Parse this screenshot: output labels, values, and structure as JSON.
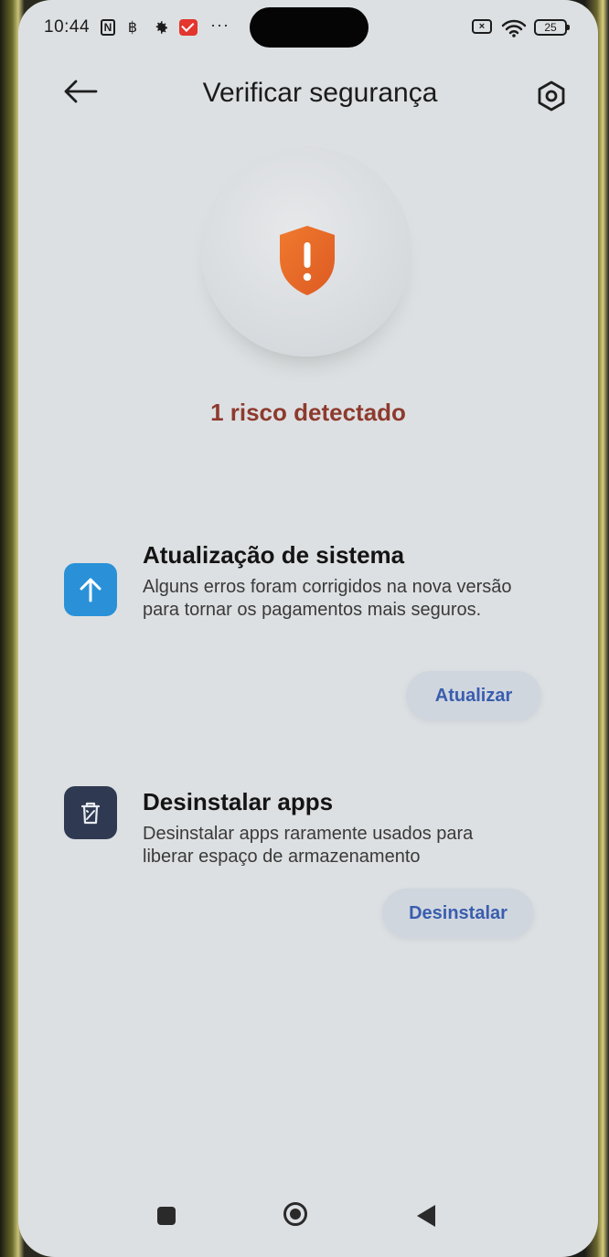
{
  "status_bar": {
    "time": "10:44",
    "nfc_glyph": "N",
    "sim_glyph": "฿",
    "more_glyph": "···",
    "battery_x_glyph": "×",
    "battery_level": "25",
    "icons": [
      "nfc-icon",
      "sim-icon",
      "gear-icon",
      "mail-icon",
      "more-icon",
      "battery-saver-icon",
      "wifi-icon",
      "battery-icon"
    ]
  },
  "header": {
    "title": "Verificar segurança",
    "back_icon": "arrow-left-icon",
    "settings_icon": "hexagon-settings-icon"
  },
  "summary": {
    "status_icon": "shield-warning-icon",
    "status_text": "1 risco detectado",
    "status_color": "#8e3a2e",
    "shield_color": "#e8692a"
  },
  "items": [
    {
      "title": "Atualização de sistema",
      "description": "Alguns erros foram corrigidos na nova versão para tornar os pagamentos mais seguros.",
      "button_label": "Atualizar",
      "icon": "arrow-up-icon",
      "icon_color": "#2a91d8"
    },
    {
      "title": "Desinstalar apps",
      "description": "Desinstalar apps raramente usados para liberar espaço de armazenamento",
      "button_label": "Desinstalar",
      "icon": "trash-icon",
      "icon_color": "#2f3a52"
    }
  ],
  "colors": {
    "screen_background": "#dde0e2",
    "button_background": "#cfd6de",
    "button_text": "#3a5dae"
  },
  "nav_bar": {
    "icons": [
      "recents-icon",
      "home-icon",
      "back-triangle-icon"
    ]
  }
}
